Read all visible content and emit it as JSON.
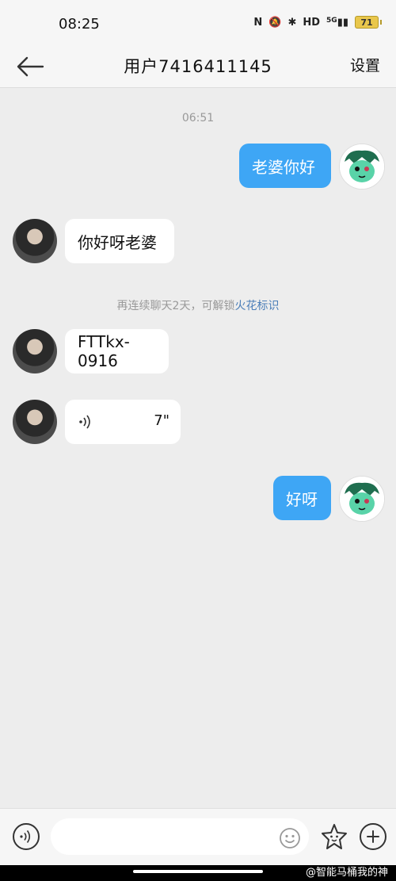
{
  "status_bar": {
    "time": "08:25",
    "network": "5G",
    "battery": "71",
    "hd": "HD"
  },
  "header": {
    "title": "用户7416411145",
    "settings_label": "设置"
  },
  "chat": {
    "timestamp": "06:51",
    "notice_prefix": "再连续聊天2天，可解锁",
    "notice_accent": "火花标识",
    "messages": [
      {
        "side": "out",
        "text": "老婆你好"
      },
      {
        "side": "in",
        "text": "你好呀老婆"
      },
      {
        "side": "in",
        "text": "FTTkx-0916"
      },
      {
        "side": "in",
        "type": "voice",
        "duration": "7\""
      },
      {
        "side": "out",
        "text": "好呀"
      }
    ]
  },
  "input_bar": {
    "placeholder": ""
  },
  "watermark": "@智能马桶我的神",
  "colors": {
    "outgoing_bubble": "#3ea6f5",
    "accent_link": "#4a7db8",
    "background": "#ededed"
  }
}
